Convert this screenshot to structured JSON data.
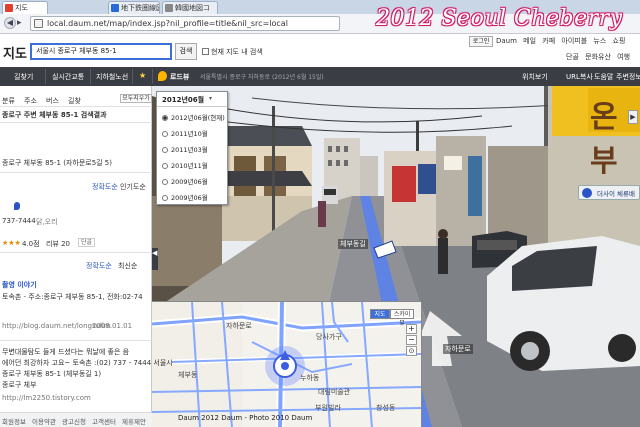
{
  "browser": {
    "tabs": [
      {
        "label": "지도",
        "active": true
      },
      {
        "label": "地下鉄圏線図",
        "active": false
      },
      {
        "label": "韓國地図コ",
        "active": false
      }
    ],
    "url": "local.daum.net/map/index.jsp?nil_profile=title&nil_src=local",
    "watermark": "2012 Seoul Cheberry"
  },
  "header": {
    "logo": "지도",
    "search_value": "서울시 종로구 체부동 85-1",
    "search_button": "검색",
    "map_search_checkbox": "현재 지도 내 검색",
    "login": "로그인",
    "top_links": [
      "Daum",
      "메일",
      "카페",
      "아이피블",
      "뉴스",
      "쇼핑"
    ],
    "sub_links": [
      "단골",
      "문화유산",
      "여행"
    ]
  },
  "toolbar": {
    "items": [
      "길찾기",
      "실시간교통",
      "지하철노선"
    ],
    "active": "로드뷰",
    "path": "서울특별시 종로구 자하동로 (2012년 6월 15일)",
    "right_items": [
      "위치보기",
      "URL복사",
      "도움말",
      "주변정보"
    ]
  },
  "left_panel": {
    "categories": [
      "분류",
      "주소",
      "버스",
      "길찾"
    ],
    "more_button": "모두지우기",
    "result_title": "종로구 주변 체부동 85-1 검색결과",
    "address_line": "종로구 체부동 85-1 (자하문로5길 5)",
    "sort_label": "정확도순",
    "sort_alt": "인기도순",
    "place_phone": "737-7444",
    "place_tag": "닭,오리",
    "place_rating": "4.0점",
    "place_reviews": "리뷰 20",
    "place_badge": "단골",
    "sort2_label": "정확도순",
    "sort2_alt": "최신순",
    "blog_title": "촬영 이야기",
    "blog_line1": "토속촌 - 주소:종로구 체부동 85-1, 전화:02-74",
    "blog_url": "http://blog.daum.net/longsulim",
    "blog_date": "2008.01.01",
    "cafe_line1": "무변대물탐도 들게 드셨다는 뭐날에 좋은 음",
    "cafe_line2": "에어던 최강하자 고요~ 토속촌 :(02) 737 - 7444 서울시",
    "cafe_line3": "종로구 체부동 85-1 (체부동길 1)",
    "cafe_line4": "종로구 체부",
    "cafe_url": "http://lm2250.tistory.com",
    "footer": [
      "회원정보",
      "이용약관",
      "광고신청",
      "고객센터",
      "제휴제안"
    ]
  },
  "date_dropdown": {
    "current": "2012년06월",
    "options": [
      {
        "label": "2012년06월(현재)",
        "selected": true
      },
      {
        "label": "2011년10월",
        "selected": false
      },
      {
        "label": "2011년03월",
        "selected": false
      },
      {
        "label": "2010년11월",
        "selected": false
      },
      {
        "label": "2009년06월",
        "selected": false
      },
      {
        "label": "2009년06월",
        "selected": false
      }
    ]
  },
  "roadview": {
    "sign_label": "체부동길",
    "corner_label": "자하문로",
    "street_control": "더사이 체류배",
    "shop_sign": "온부"
  },
  "minimap": {
    "tabs": [
      "지도",
      "스카이뷰"
    ],
    "labels": [
      "자하문로",
      "당사가구",
      "체부동",
      "누하동",
      "대림미술관",
      "부원빌라",
      "창성동"
    ],
    "copyright": "Daum 2012 Daum - Photo 2010 Daum"
  },
  "colors": {
    "accent": "#3d6fd8",
    "toolbar": "#3a3d44",
    "watermark": "#d0206a",
    "route_blue": "#4f7fff"
  }
}
